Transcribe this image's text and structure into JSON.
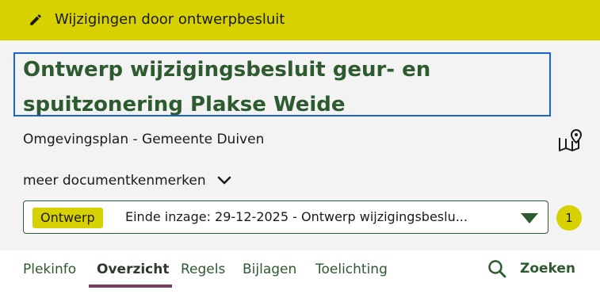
{
  "banner": {
    "icon": "pencil-icon",
    "text": "Wijzigingen door ontwerpbesluit"
  },
  "document": {
    "title": "Ontwerp wijzigingsbesluit geur- en spuitzonering Plakse Weide",
    "subtitle": "Omgevingsplan - Gemeente Duiven",
    "map_icon": "map-pin-icon",
    "meer_label": "meer documentkenmerken"
  },
  "version_select": {
    "badge": "Ontwerp",
    "value": "Einde inzage: 29-12-2025 - Ontwerp wijzigingsbeslu...",
    "count": "1"
  },
  "tabs": [
    {
      "label": "Plekinfo",
      "active": false
    },
    {
      "label": "Overzicht",
      "active": true
    },
    {
      "label": "Regels",
      "active": false
    },
    {
      "label": "Bijlagen",
      "active": false
    },
    {
      "label": "Toelichting",
      "active": false
    }
  ],
  "search": {
    "label": "Zoeken",
    "icon": "search-icon"
  },
  "colors": {
    "accent_yellow": "#d7d100",
    "brand_green": "#2d5a2f",
    "focus_blue": "#1565d8",
    "active_tab": "#7a3f62"
  }
}
